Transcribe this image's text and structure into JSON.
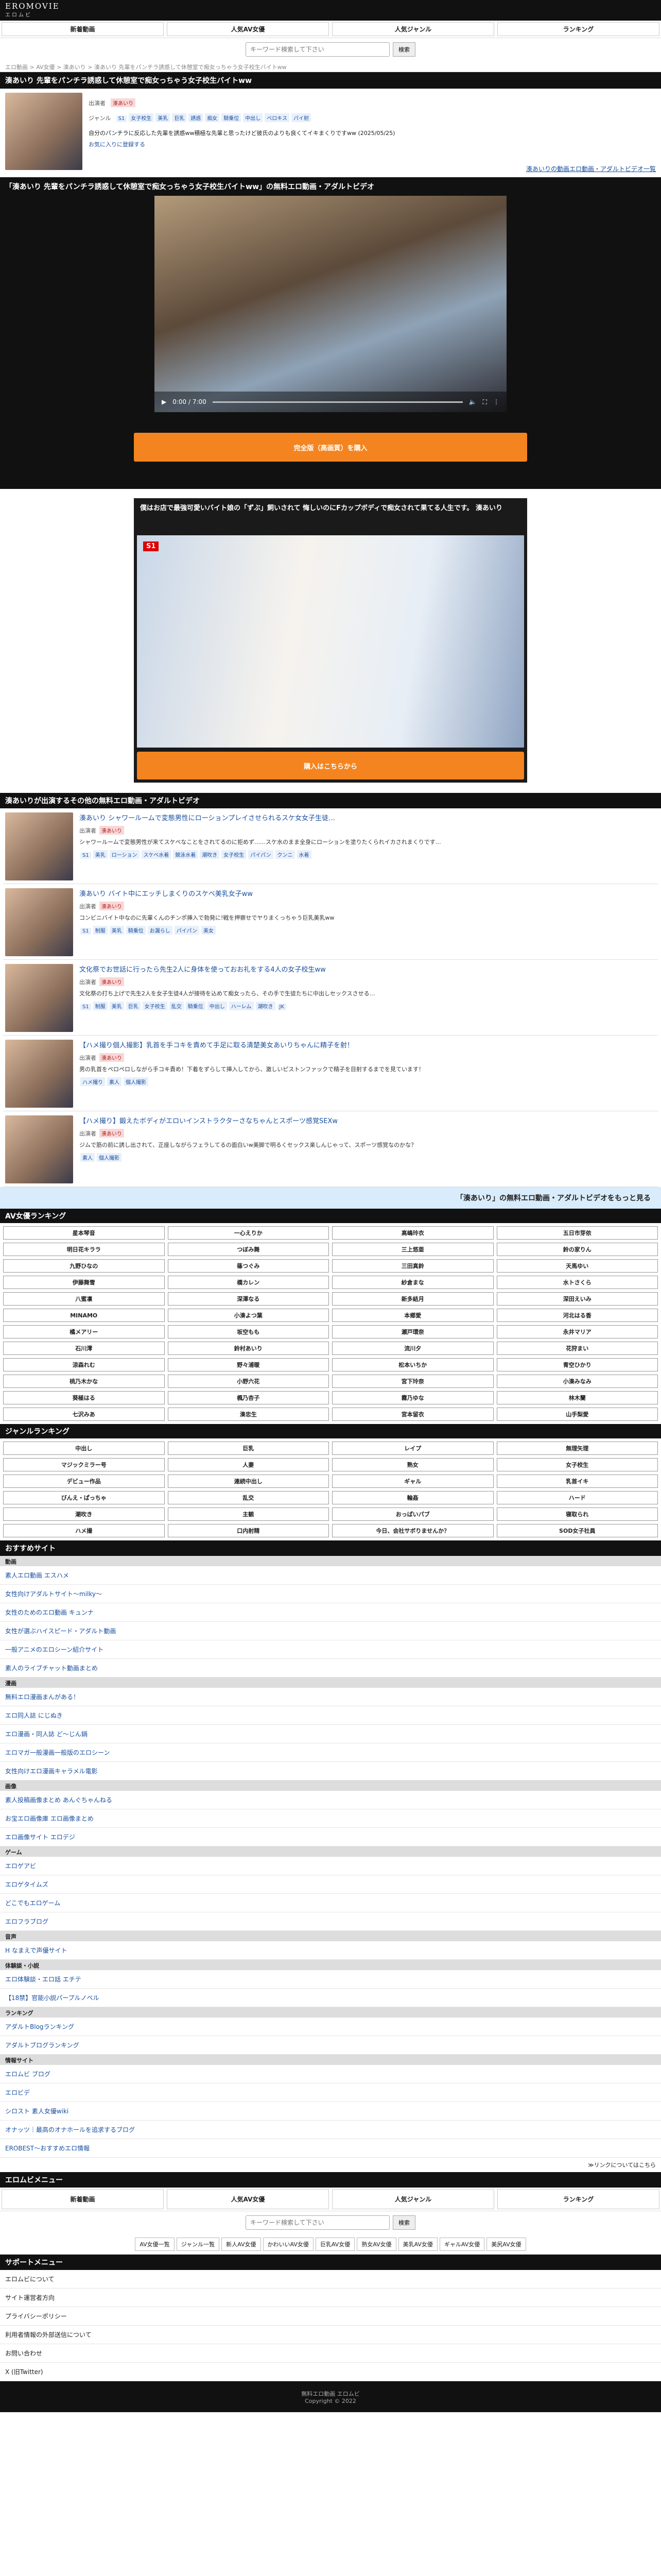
{
  "site": {
    "logo": "EROMOVIE",
    "logo_sub": "エロムビ"
  },
  "nav": [
    "新着動画",
    "人気AV女優",
    "人気ジャンル",
    "ランキング"
  ],
  "search": {
    "placeholder": "キーワード検索して下さい",
    "button": "検索"
  },
  "breadcrumb": "エロ動画 > AV女優 > 湊あいり > 湊あいり 先輩をパンチラ誘惑して休憩室で痴女っちゃう女子校生バイトww",
  "video": {
    "title": "湊あいり 先輩をパンチラ誘惑して休憩室で痴女っちゃう女子校生バイトww",
    "actress_label": "出演者",
    "actress": "湊あいり",
    "genre_label": "ジャンル",
    "genres": [
      "S1",
      "女子校生",
      "美乳",
      "巨乳",
      "誘惑",
      "痴女",
      "騎乗位",
      "中出し",
      "ベロキス",
      "パイ射"
    ],
    "desc": "自分のパンチラに反応した先輩を誘惑ww積極な先輩と思ったけど彼氏のよりも良くてイキまくりですww (2025/05/25)",
    "fav_link": "お気に入りに登録する",
    "more_link": "湊あいりの動画エロ動画・アダルトビデオ一覧"
  },
  "player": {
    "title": "「湊あいり 先輩をパンチラ誘惑して休憩室で痴女っちゃう女子校生バイトww」の無料エロ動画・アダルトビデオ",
    "time": "0:00 / 7:00",
    "buy_button": "完全版（高画質）を購入"
  },
  "ad": {
    "title": "僕はお店で最強可愛いバイト娘の「ずぶ」飼いされて 悔しいのにFカップボディで痴女されて果てる人生です。 湊あいり",
    "buy_button": "購入はこちらから",
    "logo": "S1"
  },
  "related": {
    "heading": "湊あいりが出演するその他の無料エロ動画・アダルトビデオ",
    "actress_label": "出演者",
    "items": [
      {
        "title": "湊あいり シャワールームで変態男性にローションプレイさせられるスケ女女子生徒…",
        "actress": "湊あいり",
        "desc": "シャワールームで変態男性が来てスケベなことをされてるのに拒めず……スケ水のまま全身にローションを塗りたくられイカされまくりです…",
        "tags": [
          "S1",
          "美乳",
          "ローション",
          "スケベ水着",
          "競泳水着",
          "潮吹き",
          "女子校生",
          "パイパン",
          "クンニ",
          "水着"
        ]
      },
      {
        "title": "湊あいり バイト中にエッチしまくりのスケベ美乳女子ww",
        "actress": "湊あいり",
        "desc": "コンビニバイト中なのに先輩くんのチンポ挿入で勃発に!戦を押察せでヤりまくっちゃう巨乳美乳ww",
        "tags": [
          "S1",
          "制服",
          "美乳",
          "騎乗位",
          "お漏らし",
          "パイパン",
          "美女"
        ]
      },
      {
        "title": "文化祭でお世話に行ったら先生2人に身体を使っておお礼をする4人の女子校生ww",
        "actress": "湊あいり",
        "desc": "文化祭の打ち上げで先生2人を女子生徒4人が接待を込めて痴女ったら、その手で生徒たちに中出しセックスさせる…",
        "tags": [
          "S1",
          "制服",
          "美乳",
          "巨乳",
          "女子校生",
          "乱交",
          "騎乗位",
          "中出し",
          "ハーレム",
          "潮吹き",
          "JK"
        ]
      },
      {
        "title": "【ハメ撮り個人撮影】乳首を手コキを責めて手足に取る清楚美女あいりちゃんに精子を射！",
        "actress": "湊あいり",
        "desc": "男の乳首をペロペロしながら手コキ責め！下着をずらして挿入してから、激しいピストンファックで精子を目射するまでを見ています！",
        "tags": [
          "ハメ撮り",
          "素人",
          "個人撮影"
        ]
      },
      {
        "title": "【ハメ撮り】鍛えたボディがエロいインストラクターさなちゃんとスポーツ感覚SEXw",
        "actress": "湊あいり",
        "desc": "ジムで筋の前に誘し出されて、正座しながらフェラしてるの面白いw美脚で明るくセックス楽しんじゃって、スポーツ感覚なのかな？",
        "tags": [
          "素人",
          "個人撮影"
        ]
      }
    ],
    "more": "「湊あいり」の無料エロ動画・アダルトビデオをもっと見る"
  },
  "actress_ranking": {
    "heading": "AV女優ランキング",
    "names": [
      "星本琴音",
      "一心えりか",
      "高嶋玲衣",
      "五日市芽依",
      "明日花キララ",
      "つぼみ舞",
      "三上悠亜",
      "鈴の家りん",
      "九野ひなの",
      "篠つぐみ",
      "三田真鈴",
      "天馬ゆい",
      "伊藤舞雪",
      "橋カレン",
      "紗倉まな",
      "水トさくら",
      "八蜜凛",
      "深澤なる",
      "新多結月",
      "深田えいみ",
      "MINAMO",
      "小湊よつ葉",
      "本郷愛",
      "河北はる香",
      "橘メアリー",
      "坂空もも",
      "瀬戸環奈",
      "永井マリア",
      "石川澪",
      "鈴村あいり",
      "流川夕",
      "花狩まい",
      "涼森れむ",
      "野々浦暖",
      "松本いちか",
      "青空ひかり",
      "桃乃木かな",
      "小野六花",
      "宮下玲奈",
      "小湊みなみ",
      "葵極はる",
      "楓乃杏子",
      "霧乃ゆな",
      "林木蘭",
      "七沢みあ",
      "湊忠生",
      "宮本留衣",
      "山手梨愛"
    ]
  },
  "genre_ranking": {
    "heading": "ジャンルランキング",
    "names": [
      "中出し",
      "巨乳",
      "レイプ",
      "無理矢理",
      "マジックミラー号",
      "人妻",
      "熟女",
      "女子校生",
      "デビュー作品",
      "連続中出し",
      "ギャル",
      "乳首イキ",
      "びんえ・ぱっちゃ",
      "乱交",
      "輪姦",
      "ハード",
      "潮吹き",
      "主観",
      "おっぱいパブ",
      "寝取られ",
      "ハメ撮",
      "口内射精",
      "今日、会社サボりませんか？",
      "SOD女子社員"
    ]
  },
  "recommend": {
    "heading": "おすすめサイト",
    "groups": [
      {
        "name": "動画",
        "links": [
          "素人エロ動画 エスハメ",
          "女性向けアダルトサイト〜milky〜",
          "女性のためのエロ動画 キュンナ",
          "女性が選ぶハイスピード・アダルト動画",
          "一般アニメのエロシーン紹介サイト",
          "素人のライブチャット動画まとめ"
        ]
      },
      {
        "name": "漫画",
        "links": [
          "無料エロ漫画まんがある！",
          "エロ同人誌 にじぬき",
          "エロ漫画・同人誌 ど〜じん鍋",
          "エロマガ一般漫画一般版のエロシーン",
          "女性向けエロ漫画キャラメル電影"
        ]
      },
      {
        "name": "画像",
        "links": [
          "素人投稿画像まとめ あんぐちゃんねる",
          "お宝エロ画像庫 エロ画像まとめ",
          "エロ画像サイト エロデジ"
        ]
      },
      {
        "name": "ゲーム",
        "links": [
          "エロゲアビ",
          "エロゲタイムズ",
          "どこでもエロゲーム",
          "エロフラブログ"
        ]
      },
      {
        "name": "音声",
        "links": [
          "H なまえで声優サイト"
        ]
      },
      {
        "name": "体験談・小説",
        "links": [
          "エロ体験談・エロ話 エチテ",
          "【18禁】官能小説パープルノベル"
        ]
      },
      {
        "name": "ランキング",
        "links": [
          "アダルトBlogランキング",
          "アダルトブログランキング"
        ]
      },
      {
        "name": "情報サイト",
        "links": [
          "エロムビ ブログ",
          "エロビデ",
          "シロスト 素人女優wiki",
          "オナッツ｜最高のオナホールを追求するブログ",
          "EROBEST〜おすすめエロ情報"
        ]
      }
    ],
    "footer_link": "≫リンクについてはこちら"
  },
  "site_menu": {
    "heading": "エロムビメニュー",
    "nav": [
      "新着動画",
      "人気AV女優",
      "人気ジャンル",
      "ランキング"
    ],
    "sublinks": [
      "AV女優一覧",
      "ジャンル一覧",
      "新人AV女優",
      "かわいいAV女優",
      "巨乳AV女優",
      "熟女AV女優",
      "美乳AV女優",
      "ギャルAV女優",
      "美尻AV女優"
    ]
  },
  "support": {
    "heading": "サポートメニュー",
    "links": [
      "エロムビについて",
      "サイト運営者方向",
      "プライバシーポリシー",
      "利用者情報の外部送信について",
      "お問い合わせ",
      "X (旧Twitter)"
    ]
  },
  "footer": {
    "line1": "無料エロ動画 エロムビ",
    "line2": "Copyright © 2022"
  }
}
